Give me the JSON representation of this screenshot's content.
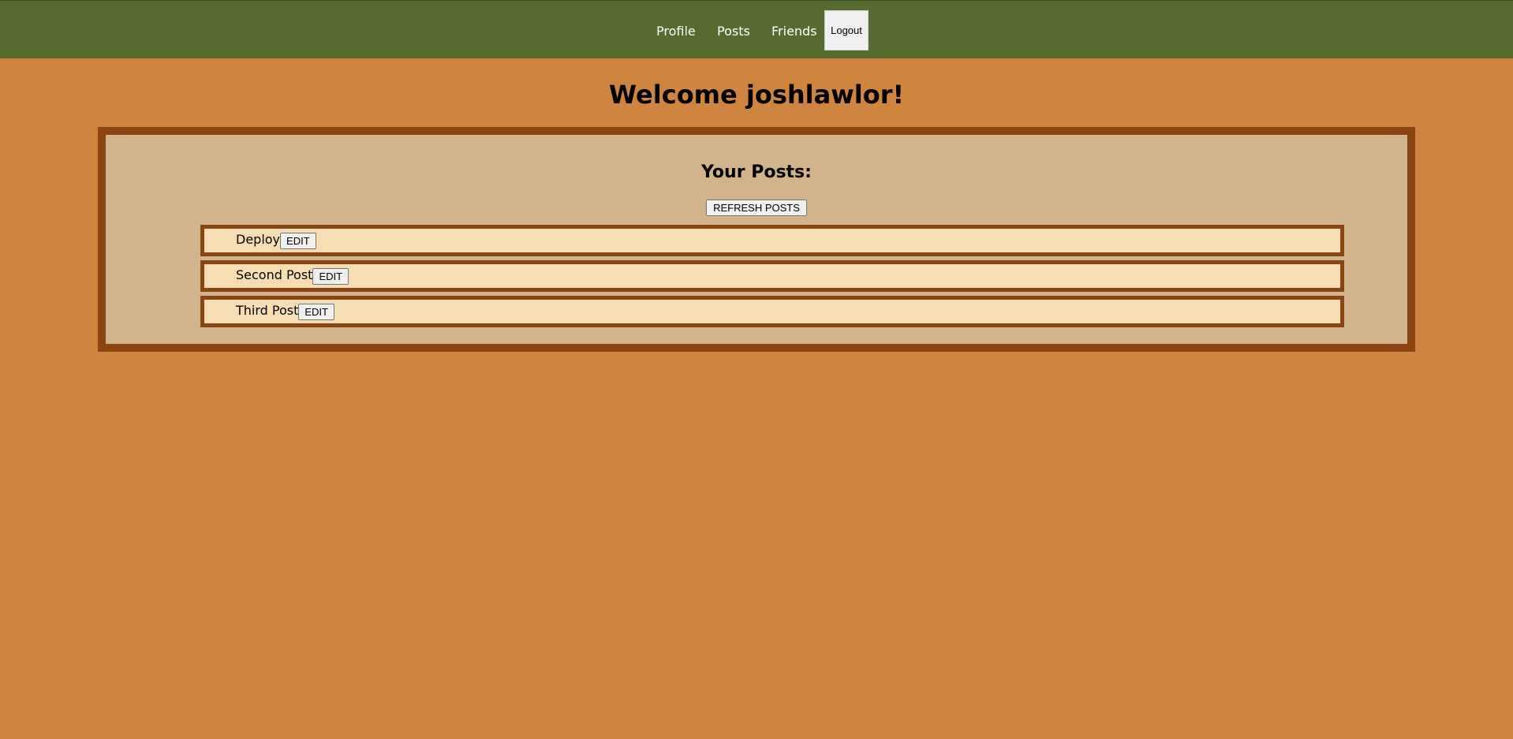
{
  "nav": {
    "profile": "Profile",
    "posts": "Posts",
    "friends": "Friends",
    "logout": "Logout"
  },
  "welcome": "Welcome joshlawlor!",
  "posts_section": {
    "heading": "Your Posts:",
    "refresh_label": "REFRESH POSTS",
    "items": [
      {
        "title": "Deploy",
        "edit_label": "EDIT"
      },
      {
        "title": "Second Post",
        "edit_label": "EDIT"
      },
      {
        "title": "Third Post",
        "edit_label": "EDIT"
      }
    ]
  },
  "colors": {
    "page_background": "#cd853f",
    "topbar": "#556b2f",
    "panel_background": "#d2b48c",
    "panel_border": "#8b4513",
    "post_background": "#f5deb3"
  }
}
